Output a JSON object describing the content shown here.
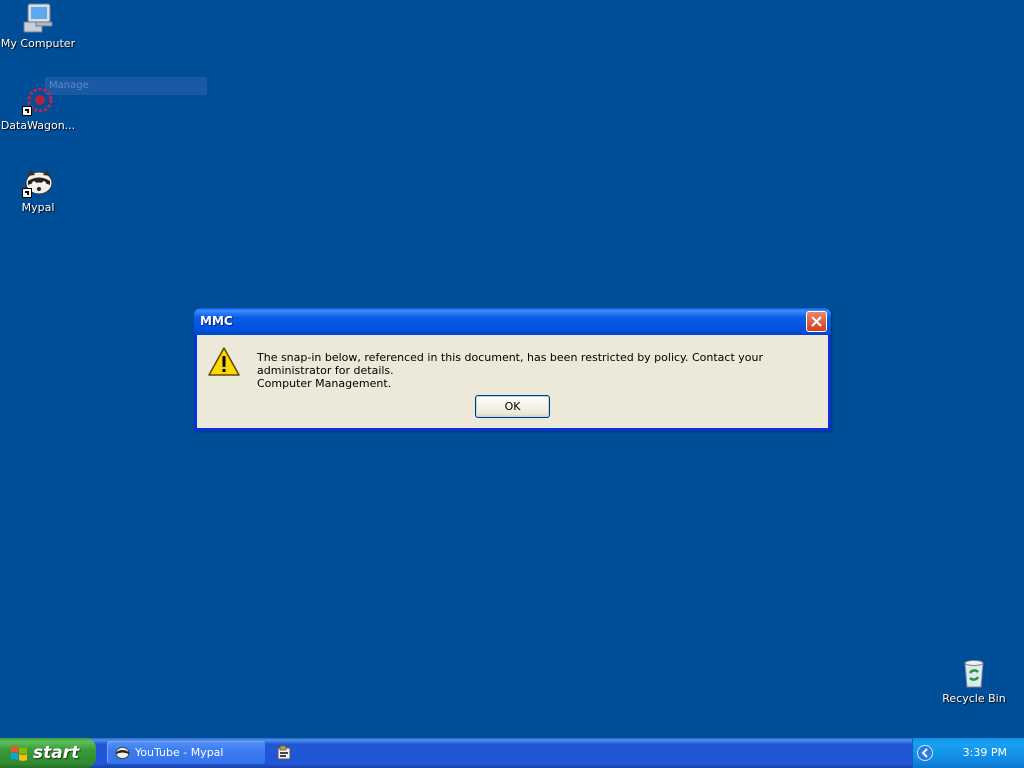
{
  "desktop": {
    "icons": [
      {
        "label": "My Computer"
      },
      {
        "label": "DataWagon..."
      },
      {
        "label": "Mypal"
      },
      {
        "label": "Recycle Bin"
      }
    ],
    "ghost_label": "Manage"
  },
  "dialog": {
    "title": "MMC",
    "message_line1": "The snap-in below, referenced in this document, has been restricted by policy. Contact your administrator for details.",
    "message_line2": "Computer Management.",
    "ok_label": "OK"
  },
  "taskbar": {
    "start_label": "start",
    "task_item": "YouTube - Mypal",
    "clock": "3:39 PM"
  },
  "colors": {
    "desktop_bg": "#004e98",
    "titlebar": "#0a5ce6",
    "dialog_body": "#ece9d8",
    "start_green": "#3a9a3a",
    "tray": "#0f86e2"
  }
}
